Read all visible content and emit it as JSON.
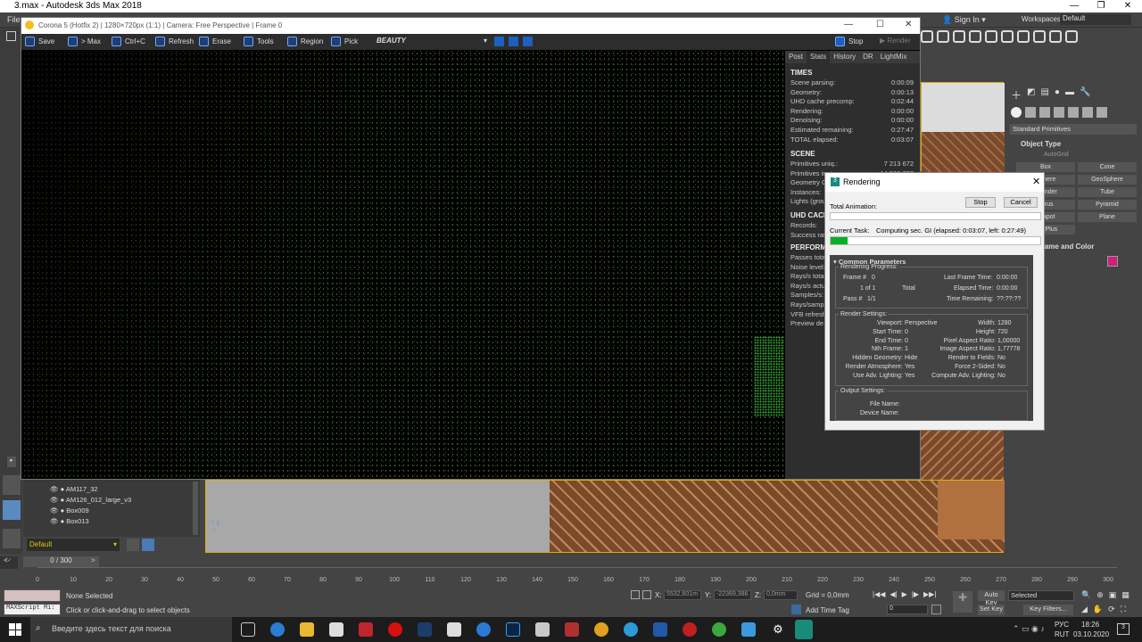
{
  "app": {
    "title": "3.max - Autodesk 3ds Max 2018",
    "menu_first": "File",
    "sign_in": "Sign In",
    "workspaces_label": "Workspaces:",
    "workspace_value": "Default"
  },
  "vfb": {
    "title": "Corona 5 (Hotfix 2) | 1280×720px (1:1) | Camera: Free Perspective | Frame 0",
    "toolbar": {
      "save": "Save",
      "to_max": "> Max",
      "ctrl_c": "Ctrl+C",
      "refresh": "Refresh",
      "erase": "Erase",
      "tools": "Tools",
      "region": "Region",
      "pick": "Pick",
      "channel": "BEAUTY",
      "stop": "Stop",
      "render": "Render"
    }
  },
  "stats": {
    "tabs": [
      "Post",
      "Stats",
      "History",
      "DR",
      "LightMix"
    ],
    "times_header": "TIMES",
    "times": [
      [
        "Scene parsing:",
        "0:00:09"
      ],
      [
        "Geometry:",
        "0:00:13"
      ],
      [
        "UHD cache precomp:",
        "0:02:44"
      ],
      [
        "Rendering:",
        "0:00:00"
      ],
      [
        "Denoising:",
        "0:00:00"
      ],
      [
        "Estimated remaining:",
        "0:27:47"
      ],
      [
        "TOTAL elapsed:",
        "0:03:07"
      ]
    ],
    "scene_header": "SCENE",
    "scene": [
      [
        "Primitives uniq.:",
        "7 213 672"
      ],
      [
        "Primitives inst.:",
        "14 209 732"
      ],
      [
        "Geometry GB:",
        ""
      ],
      [
        "Instances:",
        ""
      ],
      [
        "Lights (groups):",
        ""
      ]
    ],
    "uhd_header": "UHD CACHE",
    "uhd": [
      [
        "Records:",
        ""
      ],
      [
        "Success rate:",
        ""
      ]
    ],
    "perf_header": "PERFORMANCE",
    "perf": [
      "Passes total:",
      "Noise level:",
      "Rays/s total:",
      "Rays/s actual:",
      "Samples/s:",
      "Rays/sample:",
      "VFB refresh:",
      "Preview de..."
    ]
  },
  "dialog": {
    "title": "Rendering",
    "stop": "Stop",
    "cancel": "Cancel",
    "total_animation": "Total Animation:",
    "current_task_label": "Current Task:",
    "current_task": "Computing sec. GI (elapsed: 0:03:07, left: 0:27:49)",
    "current_progress": 0.08,
    "common": "Common Parameters",
    "rendering_progress": "Rendering Progress:",
    "frame_label": "Frame #",
    "frame_value": "0",
    "of_label": "1 of 1",
    "total_label": "Total",
    "pass_label": "Pass #",
    "pass_value": "1/1",
    "last_frame_time_label": "Last Frame Time:",
    "last_frame_time": "0:00:00",
    "elapsed_time_label": "Elapsed Time:",
    "elapsed_time": "0:00:00",
    "time_remaining_label": "Time Remaining:",
    "time_remaining": "??:??:??",
    "render_settings": "Render Settings:",
    "left_params": [
      [
        "Viewport:",
        "Perspective"
      ],
      [
        "Start Time:",
        "0"
      ],
      [
        "End Time:",
        "0"
      ],
      [
        "Nth Frame:",
        "1"
      ],
      [
        "Hidden Geometry:",
        "Hide"
      ],
      [
        "Render Atmosphere:",
        "Yes"
      ],
      [
        "Use Adv. Lighting:",
        "Yes"
      ]
    ],
    "right_params": [
      [
        "Width:",
        "1280"
      ],
      [
        "Height:",
        "720"
      ],
      [
        "Pixel Aspect Ratio:",
        "1,00000"
      ],
      [
        "Image Aspect Ratio:",
        "1,77778"
      ],
      [
        "Render to Fields:",
        "No"
      ],
      [
        "Force 2-Sided:",
        "No"
      ],
      [
        "Compute Adv. Lighting:",
        "No"
      ]
    ],
    "output_settings": "Output Settings:",
    "file_name_label": "File Name:",
    "device_name_label": "Device Name:"
  },
  "command_panel": {
    "dropdown": "Standard Primitives",
    "object_type": "Object Type",
    "autogrid": "AutoGrid",
    "buttons": [
      "Box",
      "Cone",
      "Sphere",
      "GeoSphere",
      "Cylinder",
      "Tube",
      "Torus",
      "Pyramid",
      "Teapot",
      "Plane",
      "TextPlus"
    ],
    "name_color": "Name and Color",
    "color_swatch": "#d0207a"
  },
  "scene_explorer": {
    "items": [
      "AM117_32",
      "AM126_012_large_v3",
      "Box009",
      "Box013"
    ],
    "layer": "Default"
  },
  "timeline": {
    "range": "0 / 300",
    "ticks": [
      "0",
      "10",
      "20",
      "30",
      "40",
      "50",
      "60",
      "70",
      "80",
      "90",
      "100",
      "110",
      "120",
      "130",
      "140",
      "150",
      "160",
      "170",
      "180",
      "190",
      "200",
      "210",
      "220",
      "230",
      "240",
      "250",
      "260",
      "270",
      "280",
      "290",
      "300"
    ]
  },
  "status": {
    "maxscript": "MAXScript Mi:",
    "none_selected": "None Selected",
    "hint": "Click or click-and-drag to select objects",
    "x_label": "X:",
    "x_value": "5532,601m",
    "y_label": "Y:",
    "y_value": "-22369,386",
    "z_label": "Z:",
    "z_value": "0,0mm",
    "grid": "Grid = 0,0mm",
    "add_time_tag": "Add Time Tag",
    "auto_key": "Auto Key",
    "selected": "Selected",
    "set_key": "Set Key",
    "key_filters": "Key Filters...",
    "frame": "0"
  },
  "taskbar": {
    "search": "Введите здесь текст для поиска",
    "lang": "РУС",
    "layout": "RUT",
    "time": "18:26",
    "date": "03.10.2020",
    "notif": "3"
  }
}
